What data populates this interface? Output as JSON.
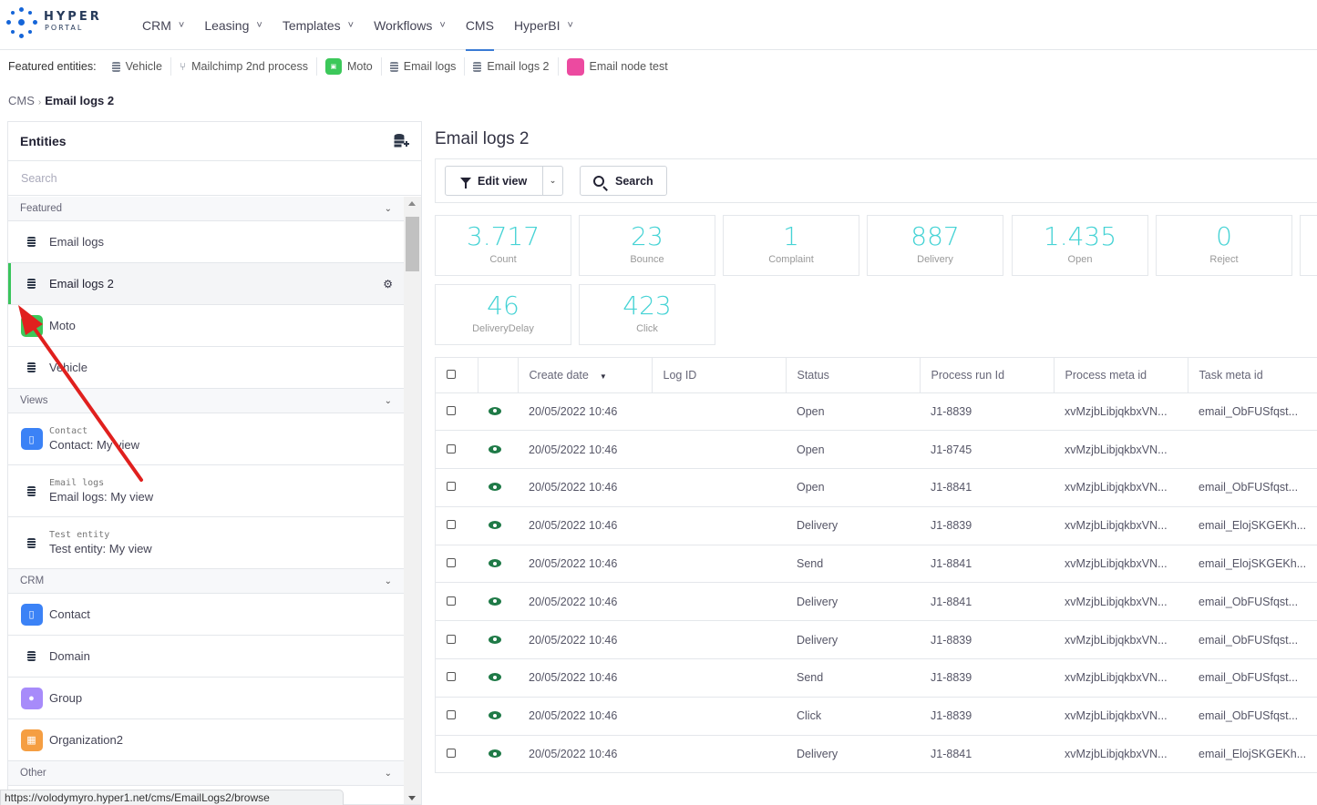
{
  "brand": {
    "word": "HYPER",
    "sub": "PORTAL",
    "color": "#1565d8"
  },
  "nav": [
    {
      "label": "CRM",
      "chevron": true
    },
    {
      "label": "Leasing",
      "chevron": true
    },
    {
      "label": "Templates",
      "chevron": true
    },
    {
      "label": "Workflows",
      "chevron": true
    },
    {
      "label": "CMS",
      "chevron": false,
      "active": true
    },
    {
      "label": "HyperBI",
      "chevron": true
    }
  ],
  "featured": {
    "label": "Featured entities:",
    "items": [
      {
        "label": "Vehicle",
        "icon": "database-icon"
      },
      {
        "label": "Mailchimp 2nd process",
        "icon": "workflow-icon"
      },
      {
        "label": "Moto",
        "icon": "moto-tile-icon"
      },
      {
        "label": "Email logs",
        "icon": "database-icon"
      },
      {
        "label": "Email logs 2",
        "icon": "database-icon"
      },
      {
        "label": "Email node test",
        "icon": "pink-tile-icon"
      }
    ]
  },
  "breadcrumb": {
    "root": "CMS",
    "current": "Email logs 2"
  },
  "entities": {
    "title": "Entities",
    "search_placeholder": "Search",
    "sections": {
      "featured": "Featured",
      "views": "Views",
      "crm": "CRM",
      "other": "Other"
    },
    "featured_items": [
      "Email logs",
      "Email logs 2",
      "Moto",
      "Vehicle"
    ],
    "views": [
      {
        "entity": "Contact",
        "label": "Contact: My view"
      },
      {
        "entity": "Email logs",
        "label": "Email logs: My view"
      },
      {
        "entity": "Test entity",
        "label": "Test entity: My view"
      }
    ],
    "crm_items": [
      "Contact",
      "Domain",
      "Group",
      "Organization2"
    ]
  },
  "status_url": "https://volodymyro.hyper1.net/cms/EmailLogs2/browse",
  "page": {
    "title": "Email logs 2",
    "edit_view": "Edit view",
    "search": "Search"
  },
  "stats": [
    {
      "value": "3.717",
      "label": "Count"
    },
    {
      "value": "23",
      "label": "Bounce"
    },
    {
      "value": "1",
      "label": "Complaint"
    },
    {
      "value": "887",
      "label": "Delivery"
    },
    {
      "value": "1.435",
      "label": "Open"
    },
    {
      "value": "0",
      "label": "Reject"
    },
    {
      "value": "46",
      "label": "DeliveryDelay"
    },
    {
      "value": "423",
      "label": "Click"
    }
  ],
  "accent_color": "#46d3d5",
  "table": {
    "columns": [
      "Create date",
      "Log ID",
      "Status",
      "Process run Id",
      "Process meta id",
      "Task meta id"
    ],
    "rows": [
      [
        "20/05/2022 10:46",
        "",
        "Open",
        "J1-8839",
        "xvMzjbLibjqkbxVN...",
        "email_ObFUSfqst..."
      ],
      [
        "20/05/2022 10:46",
        "",
        "Open",
        "J1-8745",
        "xvMzjbLibjqkbxVN...",
        ""
      ],
      [
        "20/05/2022 10:46",
        "",
        "Open",
        "J1-8841",
        "xvMzjbLibjqkbxVN...",
        "email_ObFUSfqst..."
      ],
      [
        "20/05/2022 10:46",
        "",
        "Delivery",
        "J1-8839",
        "xvMzjbLibjqkbxVN...",
        "email_ElojSKGEKh..."
      ],
      [
        "20/05/2022 10:46",
        "",
        "Send",
        "J1-8841",
        "xvMzjbLibjqkbxVN...",
        "email_ElojSKGEKh..."
      ],
      [
        "20/05/2022 10:46",
        "",
        "Delivery",
        "J1-8841",
        "xvMzjbLibjqkbxVN...",
        "email_ObFUSfqst..."
      ],
      [
        "20/05/2022 10:46",
        "",
        "Delivery",
        "J1-8839",
        "xvMzjbLibjqkbxVN...",
        "email_ObFUSfqst..."
      ],
      [
        "20/05/2022 10:46",
        "",
        "Send",
        "J1-8839",
        "xvMzjbLibjqkbxVN...",
        "email_ObFUSfqst..."
      ],
      [
        "20/05/2022 10:46",
        "",
        "Click",
        "J1-8839",
        "xvMzjbLibjqkbxVN...",
        "email_ObFUSfqst..."
      ],
      [
        "20/05/2022 10:46",
        "",
        "Delivery",
        "J1-8841",
        "xvMzjbLibjqkbxVN...",
        "email_ElojSKGEKh..."
      ]
    ]
  }
}
